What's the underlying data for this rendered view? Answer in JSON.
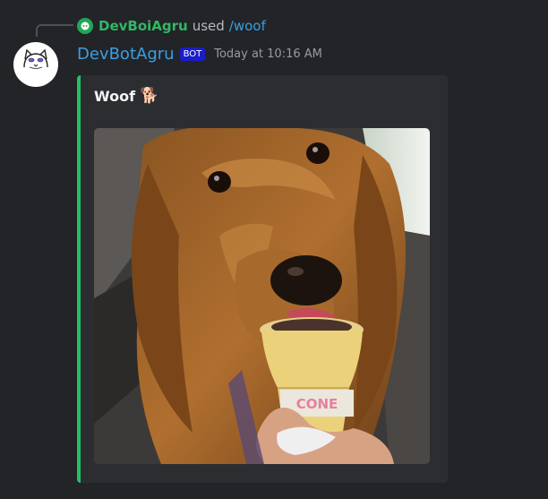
{
  "command": {
    "user": "DevBoiAgru",
    "used_text": "used",
    "command_name": "/woof"
  },
  "message": {
    "author": "DevBotAgru",
    "bot_tag": "BOT",
    "timestamp": "Today at 10:16 AM"
  },
  "embed": {
    "title": "Woof",
    "title_emoji": "🐕",
    "accent_color": "#1ec464",
    "image_text": "CONE"
  },
  "colors": {
    "background": "#222427",
    "embed_background": "#2b2d31",
    "username": "#3c9ee2",
    "command_user": "#2fb866",
    "bot_tag": "#1a1dc9"
  }
}
